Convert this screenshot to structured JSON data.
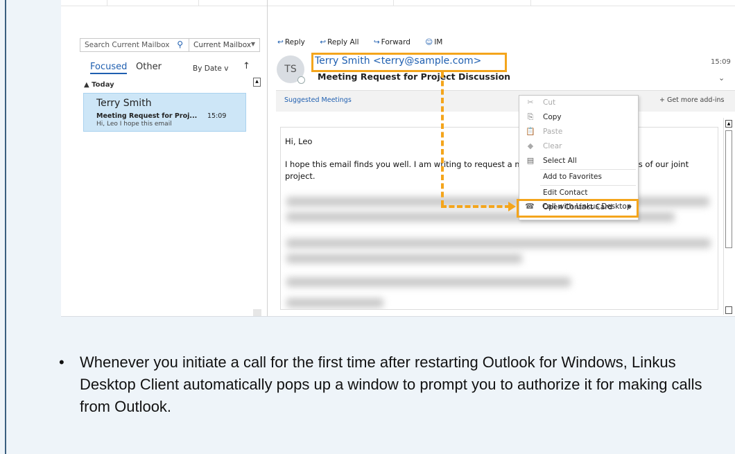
{
  "search": {
    "placeholder": "Search Current Mailbox",
    "scope": "Current Mailbox"
  },
  "tabs": {
    "focused": "Focused",
    "other": "Other"
  },
  "sort": {
    "label": "By Date",
    "chevron": "v",
    "direction_arrow": "↑"
  },
  "group_header": "▲ Today",
  "message": {
    "sender": "Terry Smith",
    "subject": "Meeting Request for Proj...",
    "time": "15:09",
    "preview": "Hi, Leo  I hope this email"
  },
  "actions": {
    "reply": "Reply",
    "reply_all": "Reply All",
    "forward": "Forward",
    "im": "IM"
  },
  "reading": {
    "avatar_initials": "TS",
    "from": "Terry Smith <terry@sample.com>",
    "subject": "Meeting Request for Project Discussion",
    "time": "15:09",
    "suggested": "Suggested Meetings",
    "addins": "+ Get more add-ins",
    "greeting": "Hi, Leo",
    "body_line": "I hope this email finds you well. I am writing to request a meeting to discuss the progress of our joint project."
  },
  "context_menu": [
    {
      "label": "Cut",
      "icon": "scissors-icon",
      "glyph": "✂",
      "disabled": true
    },
    {
      "label": "Copy",
      "icon": "copy-icon",
      "glyph": "⎘",
      "disabled": false
    },
    {
      "label": "Paste",
      "icon": "paste-icon",
      "glyph": "📋",
      "disabled": true
    },
    {
      "label": "Clear",
      "icon": "eraser-icon",
      "glyph": "◆",
      "disabled": true
    },
    {
      "label": "Select All",
      "icon": "select-all-icon",
      "glyph": "▤",
      "disabled": false
    },
    {
      "label": "Add to Favorites",
      "icon": "",
      "glyph": "",
      "disabled": false
    },
    {
      "label": "Edit Contact",
      "icon": "",
      "glyph": "",
      "disabled": false
    },
    {
      "label": "Open Contact Card",
      "icon": "",
      "glyph": "",
      "disabled": false
    },
    {
      "label": "Call with Linkus Desktop",
      "icon": "phone-icon",
      "glyph": "☎",
      "disabled": false
    }
  ],
  "caption": "Whenever you initiate a call for the first time after restarting Outlook for Windows, Linkus Desktop Client automatically pops up a window to prompt you to authorize it for making calls from Outlook.",
  "colors": {
    "accent": "#1f5fb0",
    "highlight": "#f4a51c",
    "selected_row": "#cde6f7"
  }
}
